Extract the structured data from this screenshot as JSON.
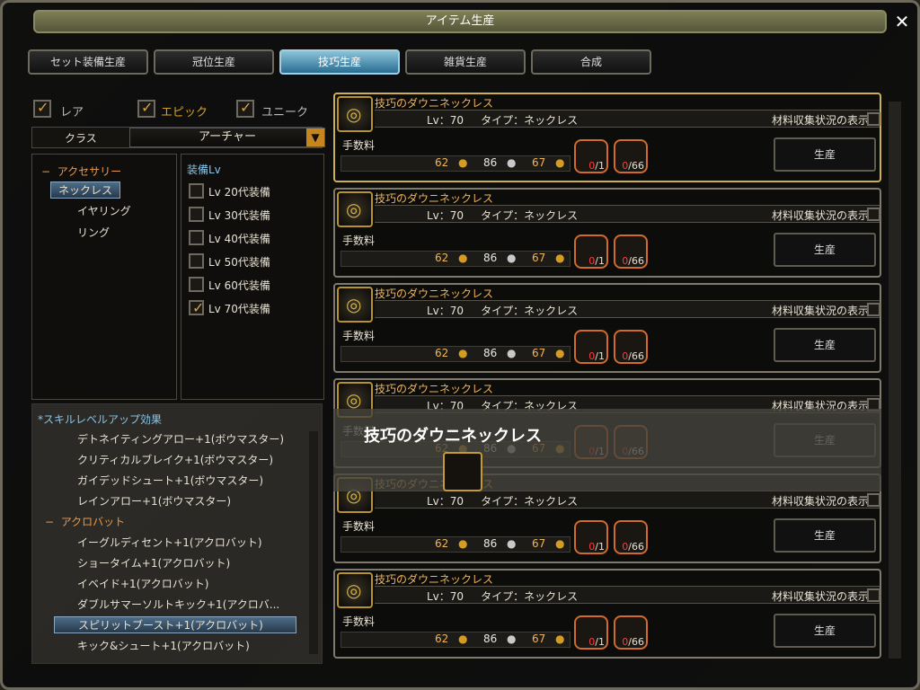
{
  "title": "アイテム生産",
  "tabs": [
    {
      "label": "セット装備生産",
      "active": false
    },
    {
      "label": "冠位生産",
      "active": false
    },
    {
      "label": "技巧生産",
      "active": true
    },
    {
      "label": "雑貨生産",
      "active": false
    },
    {
      "label": "合成",
      "active": false
    }
  ],
  "filters": {
    "rare": "レア",
    "epic": "エピック",
    "unique": "ユニーク"
  },
  "class": {
    "label": "クラス",
    "value": "アーチャー"
  },
  "tree": {
    "head": "アクセサリー",
    "items": [
      "ネックレス",
      "イヤリング",
      "リング"
    ]
  },
  "equiplv": {
    "label": "装備Lv",
    "items": [
      "Lv 20代装備",
      "Lv 30代装備",
      "Lv 40代装備",
      "Lv 50代装備",
      "Lv 60代装備",
      "Lv 70代装備"
    ]
  },
  "skills": {
    "title": "*スキルレベルアップ効果",
    "bowmaster": [
      "デトネイティングアロー+1(ボウマスター)",
      "クリティカルブレイク+1(ボウマスター)",
      "ガイデッドシュート+1(ボウマスター)",
      "レインアロー+1(ボウマスター)"
    ],
    "head2": "アクロバット",
    "acrobat": [
      "イーグルディセント+1(アクロバット)",
      "ショータイム+1(アクロバット)",
      "イベイド+1(アクロバット)",
      "ダブルサマーソルトキック+1(アクロバ...",
      "スピリットブースト+1(アクロバット)",
      "キック&シュート+1(アクロバット)"
    ]
  },
  "card": {
    "name": "技巧のダウニネックレス",
    "lv": "Lv：70",
    "type": "タイプ：ネックレス",
    "show": "材料収集状況の表示",
    "fee": "手数料",
    "gold1": "62",
    "silver": "86",
    "gold2": "67",
    "mat1": "0/1",
    "mat2": "0/66",
    "produce": "生産"
  },
  "tooltip": "技巧のダウニネックレス"
}
